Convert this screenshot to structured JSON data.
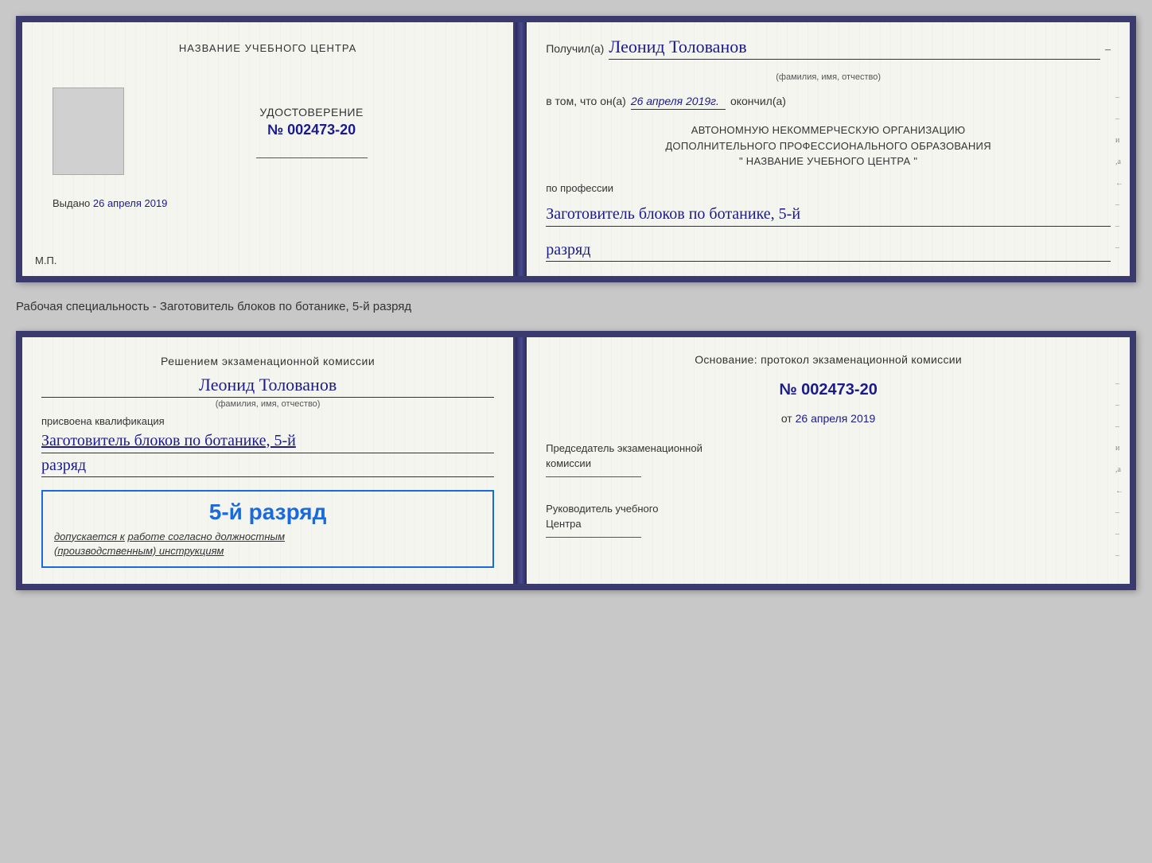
{
  "card1": {
    "left": {
      "training_center_label": "НАЗВАНИЕ УЧЕБНОГО ЦЕНТРА",
      "udostoverenie_label": "УДОСТОВЕРЕНИЕ",
      "number": "№ 002473-20",
      "vydano_label": "Выдано",
      "vydano_date": "26 апреля 2019",
      "mp_label": "М.П."
    },
    "right": {
      "poluchil_label": "Получил(а)",
      "name": "Леонид Толованов",
      "fio_subtitle": "(фамилия, имя, отчество)",
      "dash": "–",
      "v_tom_label": "в том, что он(а)",
      "date_value": "26 апреля 2019г.",
      "okonchil_label": "окончил(а)",
      "org_line1": "АВТОНОМНУЮ НЕКОММЕРЧЕСКУЮ ОРГАНИЗАЦИЮ",
      "org_line2": "ДОПОЛНИТЕЛЬНОГО ПРОФЕССИОНАЛЬНОГО ОБРАЗОВАНИЯ",
      "org_line3": "\"  НАЗВАНИЕ УЧЕБНОГО ЦЕНТРА  \"",
      "po_professii": "по профессии",
      "profession_line1": "Заготовитель блоков по ботанике, 5-й",
      "razryad_value": "разряд"
    }
  },
  "specialty_label": "Рабочая специальность - Заготовитель блоков по ботанике, 5-й разряд",
  "card2": {
    "left": {
      "resheniem_line1": "Решением экзаменационной комиссии",
      "name": "Леонид Толованов",
      "fio_subtitle": "(фамилия, имя, отчество)",
      "prisvoena": "присвоена квалификация",
      "profession_line1": "Заготовитель блоков по ботанике, 5-й",
      "razryad_value": "разряд",
      "stamp_razryad": "5-й разряд",
      "dopuskaetsya": "допускается к",
      "rabote": "работе согласно должностным",
      "instruktsiyam": "(производственным) инструкциям"
    },
    "right": {
      "osnovanie_line1": "Основание: протокол экзаменационной комиссии",
      "number": "№  002473-20",
      "ot_label": "от",
      "ot_date": "26 апреля 2019",
      "predsedatel_line1": "Председатель экзаменационной",
      "predsedatel_line2": "комиссии",
      "rukovoditel_line1": "Руководитель учебного",
      "rukovoditel_line2": "Центра"
    }
  }
}
